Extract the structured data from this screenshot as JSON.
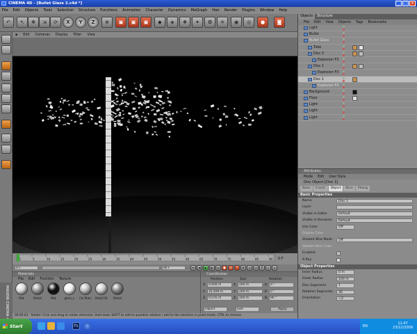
{
  "window": {
    "title": "CINEMA 4D - [Bullet Glass 2.c4d *]"
  },
  "main_menu": [
    "File",
    "Edit",
    "Objects",
    "Tools",
    "Selection",
    "Structure",
    "Functions",
    "Animation",
    "Character",
    "Dynamics",
    "MoGraph",
    "Hair",
    "Render",
    "Plugins",
    "Window",
    "Help"
  ],
  "viewport_menu": [
    "Edit",
    "Cameras",
    "Display",
    "Filter",
    "View"
  ],
  "timeline": {
    "ticks": [
      "0",
      "5",
      "10",
      "15",
      "20",
      "25",
      "30",
      "35",
      "40",
      "45",
      "50",
      "55",
      "60",
      "65",
      "70",
      "75",
      "80",
      "85",
      "90"
    ],
    "current_frame": "0 F",
    "start_field": "0 F",
    "end_field": "90 F",
    "playhead_fraction": 0.0
  },
  "materials": {
    "title": "Materials",
    "menu": [
      "File",
      "Edit",
      "Function",
      "Texture"
    ],
    "items": [
      {
        "name": "Mat",
        "color": "#d8d8d8"
      },
      {
        "name": "Detail",
        "color": "#9a9a9a"
      },
      {
        "name": "Mat",
        "color": "#111111"
      },
      {
        "name": "glass_c",
        "color": "#eeeeee"
      },
      {
        "name": "Cel Stain",
        "color": "#bbbbbb"
      },
      {
        "name": "Detail Sh",
        "color": "#cccccc"
      },
      {
        "name": "Detail",
        "color": "#888888"
      }
    ]
  },
  "coordinates": {
    "title": "Coordinates",
    "headers": [
      "Position",
      "Size",
      "Rotation"
    ],
    "rows": [
      {
        "axis": "X",
        "pos": "0.609 m",
        "size": "200 m",
        "rot_axis": "H",
        "rot": "0 °"
      },
      {
        "axis": "Y",
        "pos": "16.499 m",
        "size": "200 m",
        "rot_axis": "P",
        "rot": "0 °"
      },
      {
        "axis": "Z",
        "pos": "0.076 m",
        "size": "200 m",
        "rot_axis": "B",
        "rot": "90 °"
      }
    ],
    "mode_dropdown": "Object",
    "size_dropdown": "Size",
    "apply_label": "Apply"
  },
  "status": {
    "time": "00:00:03",
    "message": "Rotate: Click and drag to rotate elements. Hold down SHIFT to add to quantize rotation / add to the selection in point mode, CTRL to remove."
  },
  "branding": "MAXON CINEMA 4D",
  "object_manager": {
    "tabs": [
      "Objects",
      "Structure"
    ],
    "menu": [
      "File",
      "Edit",
      "View",
      "Objects",
      "Tags",
      "Bookmarks"
    ],
    "rows": [
      {
        "name": "Light",
        "indent": 0,
        "selected": false,
        "dim": false,
        "tag_colors": []
      },
      {
        "name": "Bullet",
        "indent": 0,
        "selected": false,
        "dim": false,
        "tag_colors": []
      },
      {
        "name": "Bullet Glass",
        "indent": 0,
        "selected": false,
        "dim": true,
        "tag_colors": []
      },
      {
        "name": "Tube",
        "indent": 1,
        "selected": false,
        "dim": false,
        "tag_colors": [
          "#c9924f",
          "#e6e6e6"
        ]
      },
      {
        "name": "Disc 3",
        "indent": 1,
        "selected": false,
        "dim": false,
        "tag_colors": [
          "#c9924f",
          "#bdbdbd"
        ]
      },
      {
        "name": "Explosion FX",
        "indent": 2,
        "selected": false,
        "dim": false,
        "tag_colors": []
      },
      {
        "name": "Disc 2",
        "indent": 1,
        "selected": false,
        "dim": false,
        "tag_colors": [
          "#c9924f",
          "#bdbdbd"
        ]
      },
      {
        "name": "Explosion FX",
        "indent": 2,
        "selected": false,
        "dim": false,
        "tag_colors": []
      },
      {
        "name": "Disc 1",
        "indent": 1,
        "selected": true,
        "dim": false,
        "tag_colors": [
          "#c9924f"
        ]
      },
      {
        "name": "Explosion FX",
        "indent": 2,
        "selected": false,
        "dim": true,
        "tag_colors": []
      },
      {
        "name": "Background",
        "indent": 0,
        "selected": false,
        "dim": false,
        "tag_colors": [
          "#111111"
        ]
      },
      {
        "name": "Floor",
        "indent": 0,
        "selected": false,
        "dim": false,
        "tag_colors": [
          "#dddddd"
        ]
      },
      {
        "name": "Light",
        "indent": 0,
        "selected": false,
        "dim": false,
        "tag_colors": []
      },
      {
        "name": "Light",
        "indent": 0,
        "selected": false,
        "dim": false,
        "tag_colors": []
      },
      {
        "name": "Light",
        "indent": 0,
        "selected": false,
        "dim": false,
        "tag_colors": []
      }
    ]
  },
  "attributes": {
    "title": "Attributes",
    "modes": [
      "Mode",
      "Edit",
      "User Data"
    ],
    "object_title": "Disc Object [Disc 1]",
    "tabs": [
      {
        "label": "Basic",
        "active": false
      },
      {
        "label": "Coord.",
        "active": false
      },
      {
        "label": "Object",
        "active": true
      },
      {
        "label": "Slice",
        "active": false
      },
      {
        "label": "Phong",
        "active": false
      }
    ],
    "basic_title": "Basic Properties",
    "basic": [
      {
        "k": "Name",
        "v": "Disc 1",
        "kind": "field",
        "dim": false
      },
      {
        "k": "Layer",
        "v": "",
        "kind": "field",
        "dim": false
      },
      {
        "k": "Visible in Editor",
        "v": "Default",
        "kind": "field",
        "dim": false
      },
      {
        "k": "Visible in Renderer",
        "v": "Default",
        "kind": "field",
        "dim": false
      },
      {
        "k": "Use Color",
        "v": "Off",
        "kind": "small",
        "dim": false
      },
      {
        "k": "Display Color",
        "v": "",
        "kind": "none",
        "dim": true
      },
      {
        "k": "Shaded Wire Mode",
        "v": "Off",
        "kind": "field",
        "dim": false
      },
      {
        "k": "Shaded Wire Color",
        "v": "",
        "kind": "none",
        "dim": true
      },
      {
        "k": "Enabled",
        "v": "✓",
        "kind": "check",
        "dim": false
      },
      {
        "k": "X-Ray",
        "v": "",
        "kind": "check",
        "dim": false
      }
    ],
    "object_props_title": "Object Properties",
    "object_props": [
      {
        "k": "Inner Radius",
        "v": "0 m",
        "kind": "small",
        "dim": false
      },
      {
        "k": "Outer Radius",
        "v": "100 m",
        "kind": "small",
        "dim": false
      },
      {
        "k": "Disc Segments",
        "v": "1",
        "kind": "small",
        "dim": false
      },
      {
        "k": "Rotation Segments",
        "v": "36",
        "kind": "small",
        "dim": false
      },
      {
        "k": "Orientation",
        "v": "+Z",
        "kind": "small",
        "dim": false
      }
    ]
  },
  "taskbar": {
    "start_label": "Start",
    "lang": "EN",
    "time": "11:47",
    "date": "23/12/2009"
  }
}
